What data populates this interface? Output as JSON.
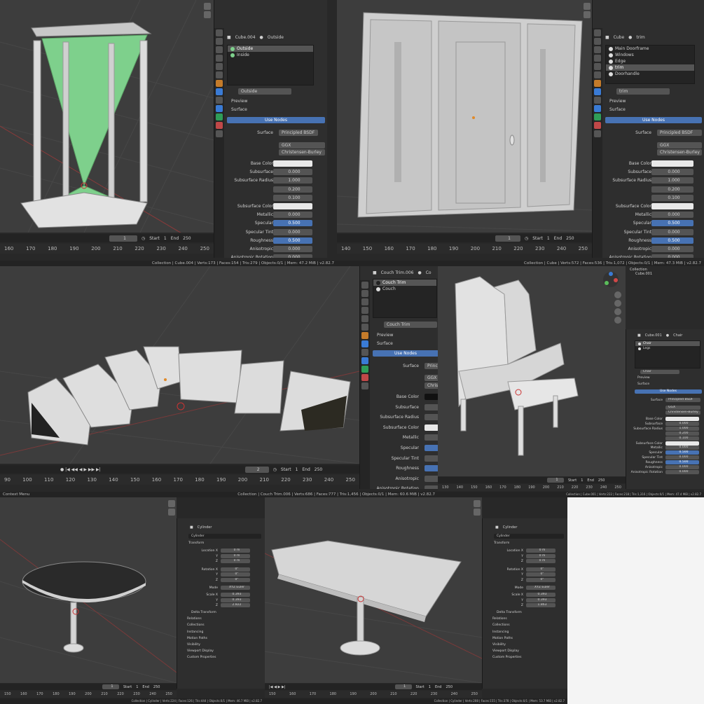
{
  "panels": {
    "top_left": {
      "object_name": "Cube.004",
      "material_name": "Outside",
      "slots": [
        {
          "name": "Outside",
          "selected": true
        },
        {
          "name": "Inside",
          "selected": false
        }
      ],
      "material_field": "Outside",
      "sections": {
        "preview": "Preview",
        "surface": "Surface"
      },
      "use_nodes": "Use Nodes",
      "surface_label": "Surface",
      "surface_value": "Principled BSDF",
      "distribution": "GGX",
      "subsurface_method": "Christensen-Burley",
      "props": [
        {
          "label": "Base Color",
          "value": ""
        },
        {
          "label": "Subsurface",
          "value": "0.000"
        },
        {
          "label": "Subsurface Radius",
          "value": "1.000"
        },
        {
          "label": "",
          "value": "0.200"
        },
        {
          "label": "",
          "value": "0.100"
        },
        {
          "label": "Subsurface Color",
          "value": ""
        },
        {
          "label": "Metallic",
          "value": "0.000"
        },
        {
          "label": "Specular",
          "value": "0.500"
        },
        {
          "label": "Specular Tint",
          "value": "0.000"
        },
        {
          "label": "Roughness",
          "value": "0.500"
        },
        {
          "label": "Anisotropic",
          "value": "0.000"
        },
        {
          "label": "Anisotropic Rotation",
          "value": "0.000"
        }
      ],
      "frame": "1",
      "start_label": "Start",
      "start": "1",
      "end_label": "End",
      "end": "250",
      "ruler": [
        "160",
        "170",
        "180",
        "190",
        "200",
        "210",
        "220",
        "230",
        "240",
        "250"
      ],
      "status": "Collection | Cube.004 | Verts:173 | Faces:154 | Tris:279 | Objects:0/1 | Mem: 47.2 MiB | v2.82.7"
    },
    "top_right": {
      "object_name": "Cube",
      "material_name": "trim",
      "slots": [
        {
          "name": "Main Doorframe",
          "selected": false
        },
        {
          "name": "Windows",
          "selected": false
        },
        {
          "name": "Edge",
          "selected": false
        },
        {
          "name": "trim",
          "selected": true
        },
        {
          "name": "Doorhandle",
          "selected": false
        }
      ],
      "material_field": "trim",
      "sections": {
        "preview": "Preview",
        "surface": "Surface"
      },
      "use_nodes": "Use Nodes",
      "surface_label": "Surface",
      "surface_value": "Principled BSDF",
      "distribution": "GGX",
      "subsurface_method": "Christensen-Burley",
      "props": [
        {
          "label": "Base Color",
          "value": ""
        },
        {
          "label": "Subsurface",
          "value": "0.000"
        },
        {
          "label": "Subsurface Radius",
          "value": "1.000"
        },
        {
          "label": "",
          "value": "0.200"
        },
        {
          "label": "",
          "value": "0.100"
        },
        {
          "label": "Subsurface Color",
          "value": ""
        },
        {
          "label": "Metallic",
          "value": "0.000"
        },
        {
          "label": "Specular",
          "value": "0.500"
        },
        {
          "label": "Specular Tint",
          "value": "0.000"
        },
        {
          "label": "Roughness",
          "value": "0.500"
        },
        {
          "label": "Anisotropic",
          "value": "0.000"
        },
        {
          "label": "Anisotropic Rotation",
          "value": "0.000"
        }
      ],
      "frame": "1",
      "start_label": "Start",
      "start": "1",
      "end_label": "End",
      "end": "250",
      "ruler": [
        "140",
        "150",
        "160",
        "170",
        "180",
        "190",
        "200",
        "210",
        "220",
        "230",
        "240",
        "250"
      ],
      "status": "Collection | Cube | Verts:572 | Faces:536 | Tris:1,072 | Objects:0/1 | Mem: 47.3 MiB | v2.82.7"
    },
    "middle_left": {
      "object_name": "Couch Trim.006",
      "material_name": "Co",
      "slots": [
        {
          "name": "Couch Trim",
          "selected": true
        },
        {
          "name": "Couch",
          "selected": false
        }
      ],
      "material_field": "Couch Trim",
      "sections": {
        "preview": "Preview",
        "surface": "Surface"
      },
      "use_nodes": "Use Nodes",
      "surface_label": "Surface",
      "surface_value": "Princip",
      "distribution": "GGX",
      "subsurface_method": "Christ",
      "props": [
        {
          "label": "Base Color",
          "value": ""
        },
        {
          "label": "Subsurface",
          "value": ""
        },
        {
          "label": "Subsurface Radius",
          "value": ""
        },
        {
          "label": "Subsurface Color",
          "value": ""
        },
        {
          "label": "Metallic",
          "value": ""
        },
        {
          "label": "Specular",
          "value": ""
        },
        {
          "label": "Specular Tint",
          "value": ""
        },
        {
          "label": "Roughness",
          "value": ""
        },
        {
          "label": "Anisotropic",
          "value": ""
        },
        {
          "label": "Anisotropic Rotation",
          "value": ""
        }
      ],
      "frame": "2",
      "start_label": "Start",
      "start": "1",
      "end_label": "End",
      "end": "250",
      "ruler": [
        "90",
        "100",
        "110",
        "120",
        "130",
        "140",
        "150",
        "160",
        "170",
        "180",
        "190",
        "200",
        "210",
        "220",
        "230",
        "240",
        "250"
      ],
      "status": "Collection | Couch Trim.006 | Verts:686 | Faces:777 | Tris:1,456 | Objects:0/1 | Mem: 60.6 MiB | v2.82.7",
      "context_menu": "Context Menu"
    },
    "middle_right": {
      "object_name": "Cube.001",
      "material_name": "Chair",
      "slots": [
        {
          "name": "Chair",
          "selected": true
        },
        {
          "name": "Legs",
          "selected": false
        }
      ],
      "material_field": "Chair",
      "sections": {
        "preview": "Preview",
        "surface": "Surface"
      },
      "use_nodes": "Use Nodes",
      "surface_label": "Surface",
      "surface_value": "Principled BSDF",
      "distribution": "GGX",
      "subsurface_method": "Christensen-Burley",
      "props": [
        {
          "label": "Base Color",
          "value": ""
        },
        {
          "label": "Subsurface",
          "value": "0.000"
        },
        {
          "label": "Subsurface Radius",
          "value": "1.000"
        },
        {
          "label": "",
          "value": "0.200"
        },
        {
          "label": "",
          "value": "0.100"
        },
        {
          "label": "Subsurface Color",
          "value": ""
        },
        {
          "label": "Metallic",
          "value": "0.000"
        },
        {
          "label": "Specular",
          "value": "0.500"
        },
        {
          "label": "Specular Tint",
          "value": "0.000"
        },
        {
          "label": "Roughness",
          "value": "0.500"
        },
        {
          "label": "Anisotropic",
          "value": "0.000"
        },
        {
          "label": "Anisotropic Rotation",
          "value": "0.000"
        }
      ],
      "outliner": [
        "Collection",
        "Cube.001"
      ],
      "frame": "1",
      "start_label": "Start",
      "start": "1",
      "end_label": "End",
      "end": "250",
      "ruler": [
        "130",
        "140",
        "150",
        "160",
        "170",
        "180",
        "190",
        "200",
        "210",
        "220",
        "230",
        "240",
        "250"
      ],
      "status": "Collection | Cube.001 | Verts:222 | Faces:218 | Tris:1,316 | Objects:0/1 | Mem: 47.4 MiB | v2.82.7"
    },
    "bottom_left": {
      "object_name": "Cylinder",
      "data_field": "Cylinder",
      "transform": "Transform",
      "rows": [
        {
          "label": "Location X",
          "value": "0 m"
        },
        {
          "label": "Y",
          "value": "0 m"
        },
        {
          "label": "Z",
          "value": "0 m"
        },
        {
          "label": "Rotation X",
          "value": "0°"
        },
        {
          "label": "Y",
          "value": "0°"
        },
        {
          "label": "Z",
          "value": "0°"
        },
        {
          "label": "Mode",
          "value": "XYZ Euler"
        },
        {
          "label": "Scale X",
          "value": "0.393"
        },
        {
          "label": "Y",
          "value": "0.393"
        },
        {
          "label": "Z",
          "value": "2.822"
        }
      ],
      "sections": [
        "Delta Transform",
        "Relations",
        "Collections",
        "Instancing",
        "Motion Paths",
        "Visibility",
        "Viewport Display",
        "Custom Properties"
      ],
      "frame": "1",
      "start_label": "Start",
      "start": "1",
      "end_label": "End",
      "end": "250",
      "ruler": [
        "150",
        "160",
        "170",
        "180",
        "190",
        "200",
        "210",
        "220",
        "230",
        "240",
        "250"
      ],
      "status": "Collection | Cylinder | Verts:224 | Faces:126 | Tris:444 | Objects:0/1 | Mem: 46.7 MiB | v2.82.7"
    },
    "bottom_right": {
      "object_name": "Cylinder",
      "data_field": "Cylinder",
      "transform": "Transform",
      "rows": [
        {
          "label": "Location X",
          "value": "0 m"
        },
        {
          "label": "Y",
          "value": "0 m"
        },
        {
          "label": "Z",
          "value": "0 m"
        },
        {
          "label": "Rotation X",
          "value": "0°"
        },
        {
          "label": "Y",
          "value": "0°"
        },
        {
          "label": "Z",
          "value": "0°"
        },
        {
          "label": "Mode",
          "value": "XYZ Euler"
        },
        {
          "label": "Scale X",
          "value": "0.393"
        },
        {
          "label": "Y",
          "value": "0.393"
        },
        {
          "label": "Z",
          "value": "1.863"
        }
      ],
      "sections": [
        "Delta Transform",
        "Relations",
        "Collections",
        "Instancing",
        "Motion Paths",
        "Visibility",
        "Viewport Display",
        "Custom Properties"
      ],
      "frame": "1",
      "start_label": "Start",
      "start": "1",
      "end_label": "End",
      "end": "250",
      "ruler": [
        "150",
        "160",
        "170",
        "180",
        "190",
        "200",
        "210",
        "220",
        "230",
        "240",
        "250"
      ],
      "status": "Collection | Cylinder | Verts:208 | Faces:155 | Tris:378 | Objects:0/1 | Mem: 53.7 MiB | v2.82.7"
    }
  },
  "colors": {
    "viewport": "#3d3d3d",
    "accent_blue": "#4772b3",
    "green_material": "#7ed08c",
    "model_white": "#dcdcdc"
  }
}
